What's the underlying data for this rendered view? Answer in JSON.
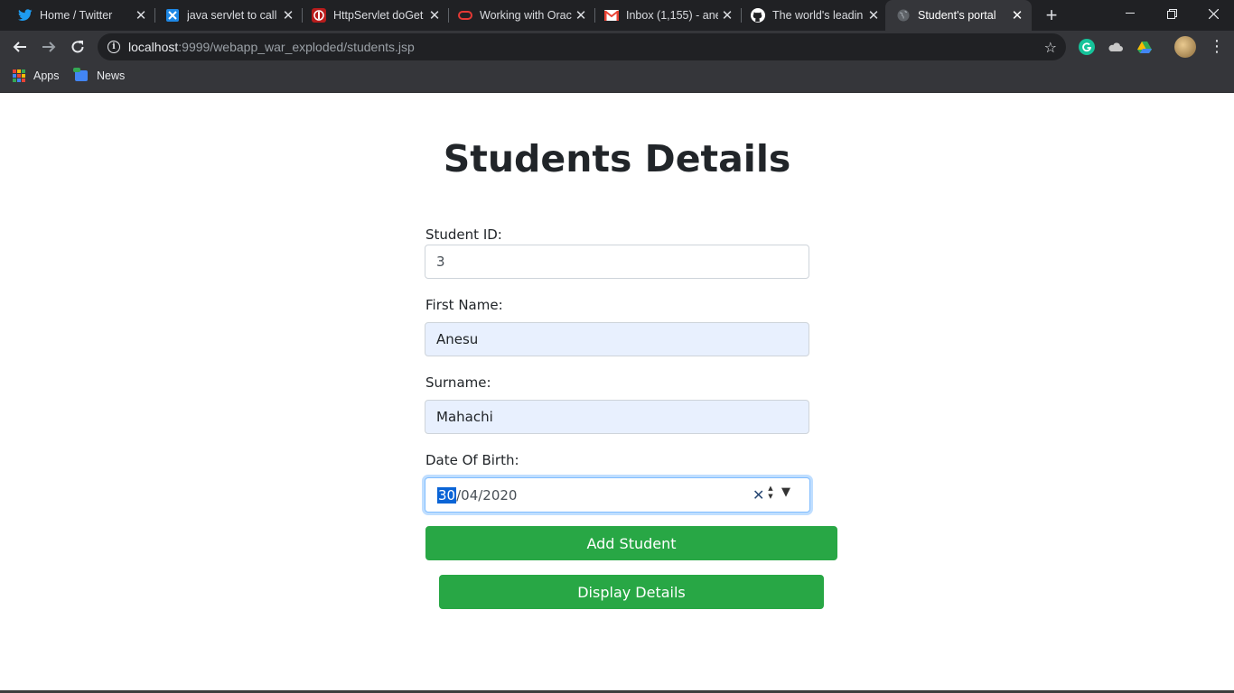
{
  "browser": {
    "tabs": [
      {
        "title": "Home / Twitter",
        "icon": "twitter-icon",
        "active": false
      },
      {
        "title": "java servlet to call",
        "icon": "stackexchange-icon",
        "active": false
      },
      {
        "title": "HttpServlet doGet",
        "icon": "javatpoint-icon",
        "active": false
      },
      {
        "title": "Working with Orac",
        "icon": "oracle-icon",
        "active": false
      },
      {
        "title": "Inbox (1,155) - ane",
        "icon": "gmail-icon",
        "active": false
      },
      {
        "title": "The world's leadin",
        "icon": "github-icon",
        "active": false
      },
      {
        "title": "Student's portal",
        "icon": "globe-icon",
        "active": true
      }
    ],
    "url_host": "localhost",
    "url_path": ":9999/webapp_war_exploded/students.jsp",
    "bookmarks": [
      {
        "label": "Apps",
        "icon": "apps-grid-icon"
      },
      {
        "label": "News",
        "icon": "news-icon"
      }
    ],
    "colors": {
      "tabbar": "#202124",
      "toolbar": "#35363a",
      "active_tab": "#35363a"
    }
  },
  "page": {
    "title": "Students Details",
    "form": {
      "student_id": {
        "label": "Student ID:",
        "value": "3"
      },
      "first_name": {
        "label": "First Name:",
        "value": "Anesu"
      },
      "surname": {
        "label": "Surname:",
        "value": "Mahachi"
      },
      "dob": {
        "label": "Date Of Birth:",
        "day": "30",
        "rest": "/04/2020"
      }
    },
    "add_button": "Add Student",
    "display_button": "Display Details",
    "colors": {
      "button": "#28a745",
      "autofill": "#e8f0fe",
      "focus": "#80bdff"
    }
  }
}
